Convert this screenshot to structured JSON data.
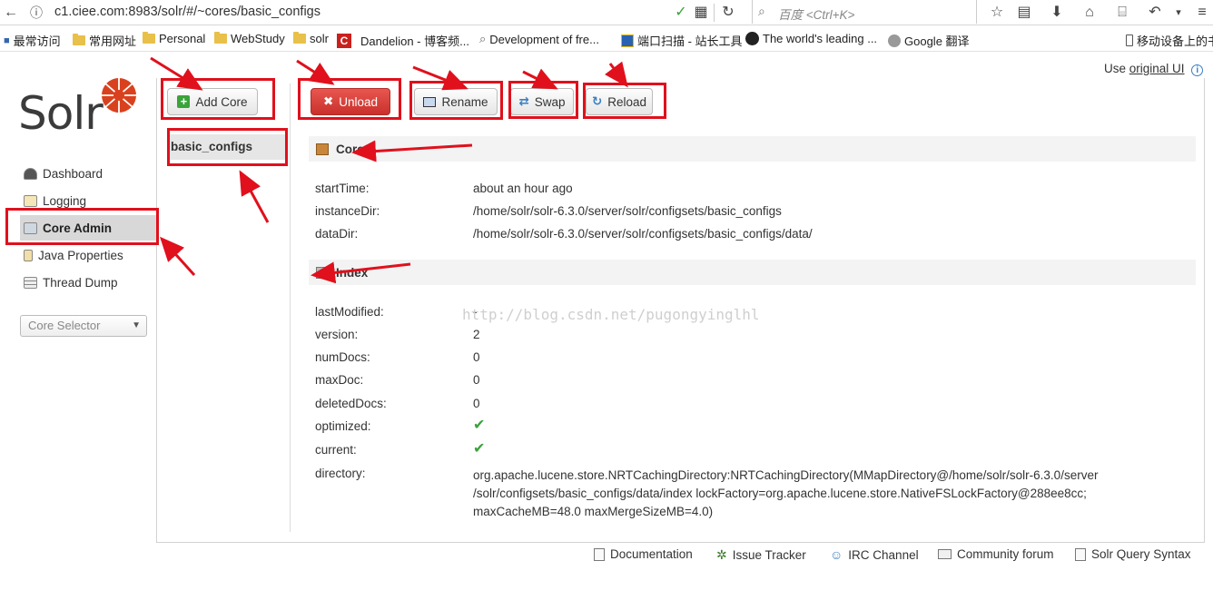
{
  "browser": {
    "url": "c1.ciee.com:8983/solr/#/~cores/basic_configs",
    "search_placeholder": "百度 <Ctrl+K>",
    "bookmarks": [
      {
        "label": "最常访问"
      },
      {
        "label": "常用网址"
      },
      {
        "label": "Personal"
      },
      {
        "label": "WebStudy"
      },
      {
        "label": "solr"
      },
      {
        "label": "Dandelion - 博客频..."
      },
      {
        "label": "Development of fre..."
      },
      {
        "label": "端口扫描 - 站长工具"
      },
      {
        "label": "The world's leading ..."
      },
      {
        "label": "Google 翻译"
      },
      {
        "label": "移动设备上的书"
      }
    ]
  },
  "header": {
    "use_prefix": "Use ",
    "original_ui_link": "original UI",
    "logo_text": "Solr"
  },
  "nav": {
    "items": [
      {
        "label": "Dashboard"
      },
      {
        "label": "Logging"
      },
      {
        "label": "Core Admin"
      },
      {
        "label": "Java Properties"
      },
      {
        "label": "Thread Dump"
      }
    ],
    "core_selector": "Core Selector"
  },
  "toolbar": {
    "add_core": "Add Core",
    "unload": "Unload",
    "rename": "Rename",
    "swap": "Swap",
    "reload": "Reload"
  },
  "cores": {
    "list": [
      "basic_configs"
    ]
  },
  "core_section": {
    "title": "Core",
    "rows": [
      {
        "key": "startTime:",
        "value": "about an hour ago"
      },
      {
        "key": "instanceDir:",
        "value": "/home/solr/solr-6.3.0/server/solr/configsets/basic_configs"
      },
      {
        "key": "dataDir:",
        "value": "/home/solr/solr-6.3.0/server/solr/configsets/basic_configs/data/"
      }
    ]
  },
  "index_section": {
    "title": "Index",
    "rows": [
      {
        "key": "lastModified:",
        "value": "-"
      },
      {
        "key": "version:",
        "value": "2"
      },
      {
        "key": "numDocs:",
        "value": "0"
      },
      {
        "key": "maxDoc:",
        "value": "0"
      },
      {
        "key": "deletedDocs:",
        "value": "0"
      },
      {
        "key": "optimized:",
        "value": "✔"
      },
      {
        "key": "current:",
        "value": "✔"
      },
      {
        "key": "directory:",
        "value": ""
      }
    ],
    "directory_lines": [
      "org.apache.lucene.store.NRTCachingDirectory:NRTCachingDirectory(MMapDirectory@/home/solr/solr-6.3.0/server",
      "/solr/configsets/basic_configs/data/index lockFactory=org.apache.lucene.store.NativeFSLockFactory@288ee8cc;",
      "maxCacheMB=48.0 maxMergeSizeMB=4.0)"
    ]
  },
  "watermark": "http://blog.csdn.net/pugongyinglhl",
  "footer": {
    "links": [
      {
        "label": "Documentation"
      },
      {
        "label": "Issue Tracker"
      },
      {
        "label": "IRC Channel"
      },
      {
        "label": "Community forum"
      },
      {
        "label": "Solr Query Syntax"
      }
    ]
  },
  "colors": {
    "annotation": "#e0101c",
    "unload": "#d9433d",
    "solr_orange": "#d9411e",
    "check": "#3aa33a"
  }
}
